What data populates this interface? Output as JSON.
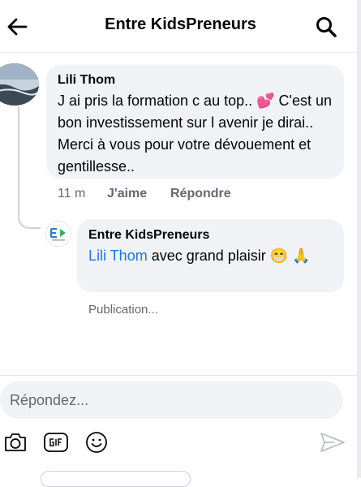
{
  "header": {
    "title": "Entre KidsPreneurs",
    "back_icon": "arrow-left-icon",
    "search_icon": "search-icon"
  },
  "comment": {
    "author": "Lili Thom",
    "text": "J ai pris la formation c au top.. 💕 C'est un bon investissement sur l avenir je dirai.. Merci à vous  pour votre dévouement et gentillesse..",
    "time": "11 m",
    "like_label": "J'aime",
    "reply_label": "Répondre"
  },
  "reply": {
    "author": "Entre KidsPreneurs",
    "mention": "Lili Thom",
    "text": " avec grand plaisir 😁 🙏",
    "status": "Publication..."
  },
  "composer": {
    "placeholder": "Répondez...",
    "tools": [
      "camera-icon",
      "gif-icon",
      "emoji-icon",
      "send-icon"
    ]
  },
  "colors": {
    "bubble": "#f0f2f5",
    "mention": "#1877f2",
    "secondary_text": "#65676b"
  }
}
